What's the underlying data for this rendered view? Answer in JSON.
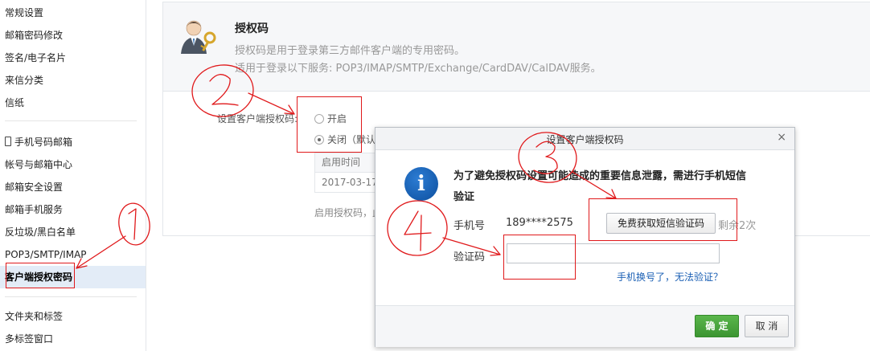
{
  "sidebar": {
    "items": [
      {
        "label": "常规设置"
      },
      {
        "label": "邮箱密码修改"
      },
      {
        "label": "签名/电子名片"
      },
      {
        "label": "来信分类"
      },
      {
        "label": "信纸"
      },
      {
        "label": "手机号码邮箱"
      },
      {
        "label": "帐号与邮箱中心"
      },
      {
        "label": "邮箱安全设置"
      },
      {
        "label": "邮箱手机服务"
      },
      {
        "label": "反垃圾/黑白名单"
      },
      {
        "label": "POP3/SMTP/IMAP"
      },
      {
        "label": "客户端授权密码"
      },
      {
        "label": "文件夹和标签"
      },
      {
        "label": "多标签窗口"
      }
    ]
  },
  "main": {
    "title": "授权码",
    "desc1": "授权码是用于登录第三方邮件客户端的专用密码。",
    "desc2": "适用于登录以下服务: POP3/IMAP/SMTP/Exchange/CardDAV/CalDAV服务。",
    "setting_label": "设置客户端授权码:",
    "option_on": "开启",
    "option_off": "关闭（默认",
    "table_header": "启用时间",
    "table_value": "2017-03-17",
    "enable_note": "启用授权码，此"
  },
  "dialog": {
    "title": "设置客户端授权码",
    "close": "×",
    "warning_line1": "为了避免授权码设置可能造成的重要信息泄露，需进行手机短信",
    "warning_line2": "验证",
    "phone_label": "手机号",
    "phone_number": "189****2575",
    "sms_button": "免费获取短信验证码",
    "remaining": "剩余2次",
    "code_label": "验证码",
    "code_value": "",
    "change_phone_link": "手机换号了，无法验证？",
    "ok_button": "确 定",
    "cancel_button": "取 消"
  },
  "annotations": {
    "marks": [
      "1",
      "2",
      "3",
      "4"
    ],
    "color": "#e0191b"
  },
  "colors": {
    "active_bg": "#e3ecf7",
    "ok_green": "#3c9532",
    "link_blue": "#1a5fb4",
    "annotation_red": "#e0191b"
  }
}
